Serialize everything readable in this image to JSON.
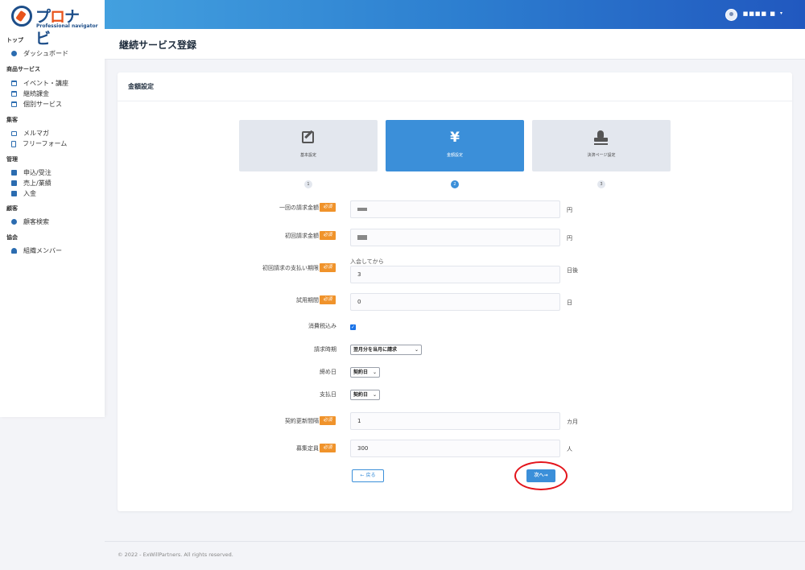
{
  "app": {
    "logo_text": "プロナビ",
    "logo_subtitle": "Professional navigator"
  },
  "header": {
    "user_name": "■■■■ ■",
    "caret": "▾"
  },
  "page": {
    "title": "継続サービス登録"
  },
  "sidebar": {
    "sections": [
      {
        "title": "トップ",
        "items": [
          {
            "label": "ダッシュボード",
            "icon": "dashboard-icon"
          }
        ]
      },
      {
        "title": "商品サービス",
        "items": [
          {
            "label": "イベント・講座",
            "icon": "calendar-icon"
          },
          {
            "label": "継続課金",
            "icon": "calendar-icon"
          },
          {
            "label": "個別サービス",
            "icon": "calendar-icon"
          }
        ]
      },
      {
        "title": "集客",
        "items": [
          {
            "label": "メルマガ",
            "icon": "mail-icon"
          },
          {
            "label": "フリーフォーム",
            "icon": "document-icon"
          }
        ]
      },
      {
        "title": "管理",
        "items": [
          {
            "label": "申込/受注",
            "icon": "folder-icon"
          },
          {
            "label": "売上/業績",
            "icon": "folder-icon"
          },
          {
            "label": "入金",
            "icon": "folder-icon"
          }
        ]
      },
      {
        "title": "顧客",
        "items": [
          {
            "label": "顧客検索",
            "icon": "users-icon"
          }
        ]
      },
      {
        "title": "協会",
        "items": [
          {
            "label": "組織メンバー",
            "icon": "user-icon"
          }
        ]
      }
    ]
  },
  "card": {
    "title": "金額設定"
  },
  "steps": [
    {
      "label": "基本設定",
      "number": "1",
      "icon": "pencil-icon",
      "active": false
    },
    {
      "label": "金額設定",
      "number": "2",
      "icon": "yen-icon",
      "symbol": "¥",
      "active": true
    },
    {
      "label": "決済ページ設定",
      "number": "3",
      "icon": "stamp-icon",
      "active": false
    }
  ],
  "form": {
    "required_badge": "必須",
    "per_amount": {
      "label": "一回の請求金額",
      "value": "■",
      "unit": "円"
    },
    "first_amount": {
      "label": "初回請求金額",
      "value": "■",
      "unit": "円"
    },
    "first_due": {
      "label": "初回請求の支払い期限",
      "above": "入会してから",
      "value": "3",
      "unit": "日後"
    },
    "trial": {
      "label": "試用期間",
      "value": "0",
      "unit": "日"
    },
    "tax_included": {
      "label": "消費税込み",
      "checked": true,
      "check_mark": "✓"
    },
    "billing_timing": {
      "label": "請求時期",
      "value": "翌月分を当月に請求"
    },
    "closing_day": {
      "label": "締め日",
      "value": "契約日"
    },
    "payment_day": {
      "label": "支払日",
      "value": "契約日"
    },
    "renewal": {
      "label": "契約更新間隔",
      "value": "1",
      "unit": "カ月"
    },
    "capacity": {
      "label": "募集定員",
      "value": "300",
      "unit": "人"
    },
    "back_button": "← 戻る",
    "next_button": "次へ→"
  },
  "colors": {
    "accent": "#3b8fd9",
    "required": "#f0932b",
    "highlight": "#e3141b"
  },
  "footer": {
    "copyright": "© 2022 - ExWillPartners. All rights reserved."
  }
}
